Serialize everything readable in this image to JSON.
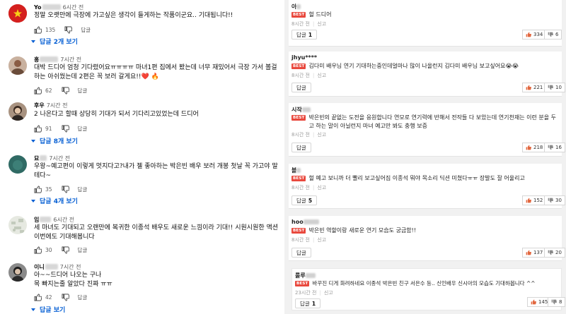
{
  "left": {
    "comments": [
      {
        "user": "Yo",
        "time": "6시간 전",
        "text": "정말 오랫만에 극장에 가고싶은 생각이 들게하는 작품이군요.. 기대됩니다!!",
        "likes": "135",
        "reply": "답글",
        "replies": "답글 2개 보기",
        "avatar_color": "#d4201e",
        "avatar_type": "flag"
      },
      {
        "user": "홍",
        "time": "7시간 전",
        "text": "대박 드디어 엄청 기다렸어요ㅠㅠㅠㅠ 마녀1편 집에서 봤는데 너무 재밌어서 극장 가서 볼걸 하는 아쉬웠는데 2편은 꼭 보러 갈게요!!❤️ 🔥",
        "likes": "62",
        "reply": "답글",
        "replies": "",
        "avatar_color": "#b58a70",
        "avatar_type": "person"
      },
      {
        "user": "후우",
        "time": "7시간 전",
        "text": "2 나온다고 할때 상당히 기대가 되서 기다리고있었는데 드디어",
        "likes": "91",
        "reply": "답글",
        "replies": "답글 8개 보기",
        "avatar_color": "#7a6654",
        "avatar_type": "person"
      },
      {
        "user": "묘",
        "time": "7시간 전",
        "text": "우왕~예고편이 이렇게 멋지다고?내가 젤 좋아하는 박은빈 배우 보러 개봉 첫날 꼭 가고야 말테다~",
        "likes": "35",
        "reply": "답글",
        "replies": "답글 4개 보기",
        "avatar_color": "#2f6a64",
        "avatar_type": "plain"
      },
      {
        "user": "임",
        "time": "6시간 전",
        "text": "세 마녀도 기대되고 오랜만에 복귀한 이종석 배우도 새로운 느낌이라 기대!! 시원시원한 액션 이번에도 기대해봅니다",
        "likes": "30",
        "reply": "답글",
        "replies": "",
        "avatar_color": "#d8ddd2",
        "avatar_type": "pattern"
      },
      {
        "user": "이니",
        "time": "7시간 전",
        "text": "아~~드디어 나오는 구나\n목 빠지는줄 알았다 진짜 ㅠㅠ",
        "likes": "42",
        "reply": "답글",
        "replies": "답글 보기",
        "avatar_color": "#4c4c4c",
        "avatar_type": "person"
      }
    ]
  },
  "right": {
    "best_label": "BEST",
    "report_label": "신고",
    "comments": [
      {
        "user": "아",
        "text": "헐 드디어",
        "time": "8시간 전",
        "reply_label": "답글",
        "reply_count": "1",
        "likes": "334",
        "dislikes": "6"
      },
      {
        "user": "jhyu****",
        "text": "김다미 배우님 연기 기대하는중인데얼마나 많이 나올런지 김다미 배우님 보고싶어요😭😭",
        "time": "8시간 전",
        "reply_label": "답글",
        "reply_count": "",
        "likes": "221",
        "dislikes": "10"
      },
      {
        "user": "시작",
        "text": "박은빈의 끝없는 도전을 응원합니다 연모로 연기력에 반해서 전작들 다 보았는데 연기천재는 이런 분을 두고 하는 말이 아닐런지 마녀 예고만 봐도 충행 보증",
        "time": "8시간 전",
        "reply_label": "답글",
        "reply_count": "",
        "likes": "218",
        "dislikes": "16"
      },
      {
        "user": "블",
        "text": "헐 예고 보니까 더 빨리 보고싶어짐 이종석 뭐야 목소리 딕션 미쳤다ㅠㅠ 장발도 잘 어울리고",
        "time": "8시간 전",
        "reply_label": "답글",
        "reply_count": "5",
        "likes": "152",
        "dislikes": "30"
      },
      {
        "user": "hoo",
        "text": "박은빈 역할이랑 새로운 연기 모습도 궁금함!!",
        "time": "8시간 전",
        "reply_label": "답글",
        "reply_count": "",
        "likes": "137",
        "dislikes": "20"
      },
      {
        "user": "룰루",
        "text": "바꾸진 디게 화려하네요 이종석 박은빈 친구 서은수 등.. 신인배우 신시아의 모습도 기대하봅니다 ^^",
        "time": "23시간 전",
        "reply_label": "답글",
        "reply_count": "1",
        "likes": "145",
        "dislikes": "8"
      }
    ]
  }
}
